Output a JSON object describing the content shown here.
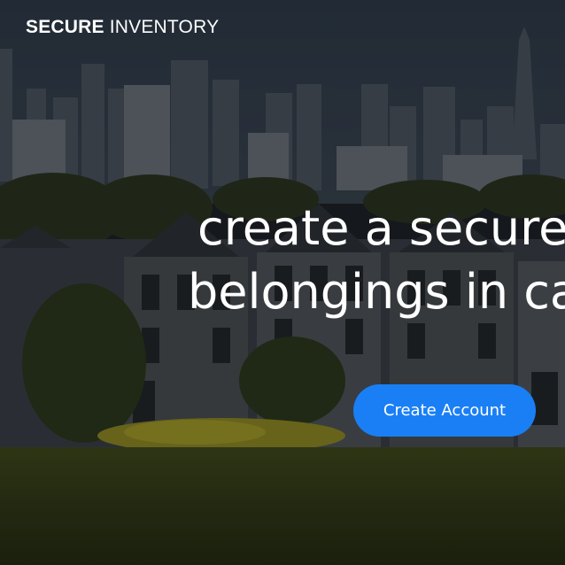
{
  "header": {
    "brand_bold": "SECURE",
    "brand_light": "INVENTORY"
  },
  "hero": {
    "line1": "create a secure",
    "line2": "belongings in ca"
  },
  "cta": {
    "label": "Create Account",
    "color": "#1a7ff5"
  }
}
